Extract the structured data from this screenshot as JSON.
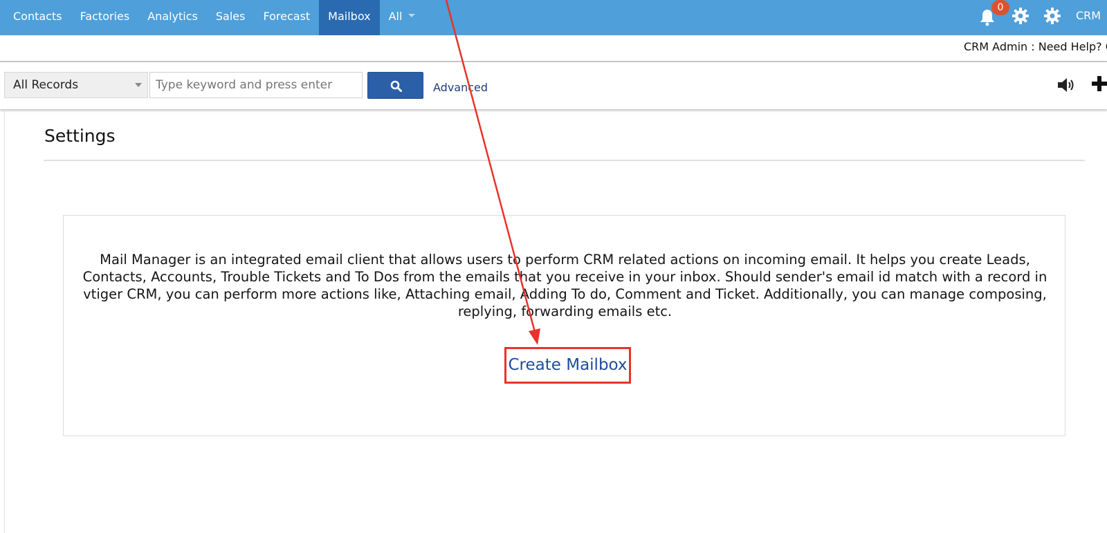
{
  "nav": {
    "items": [
      {
        "label": "Contacts",
        "active": false
      },
      {
        "label": "Factories",
        "active": false
      },
      {
        "label": "Analytics",
        "active": false
      },
      {
        "label": "Sales",
        "active": false
      },
      {
        "label": "Forecast",
        "active": false
      },
      {
        "label": "Mailbox",
        "active": true
      },
      {
        "label": "All",
        "active": false
      }
    ],
    "notification_count": "0",
    "crm_label": "CRM"
  },
  "subbar": {
    "admin_text": "CRM Admin : Need Help? C"
  },
  "search": {
    "records_select": "All Records",
    "placeholder": "Type keyword and press enter",
    "advanced_label": "Advanced"
  },
  "page": {
    "title": "Settings",
    "description": "Mail Manager is an integrated email client that allows users to perform CRM related actions on incoming email. It helps you create Leads, Contacts, Accounts, Trouble Tickets and To Dos from the emails that you receive in your inbox. Should sender's email id match with a record in vtiger CRM, you can perform more actions like, Attaching email, Adding To do, Comment and Ticket. Additionally, you can manage composing, replying, forwarding emails etc.",
    "create_button": "Create Mailbox"
  },
  "colors": {
    "navbar": "#4e9fda",
    "nav_active": "#2a6ab0",
    "search_button": "#2b5fa8",
    "annotation": "#e8322a",
    "link": "#1e4d9a"
  },
  "icons": [
    "bell-icon",
    "gear-icon",
    "search-icon",
    "speaker-icon",
    "plus-icon",
    "chevron-down-icon"
  ]
}
